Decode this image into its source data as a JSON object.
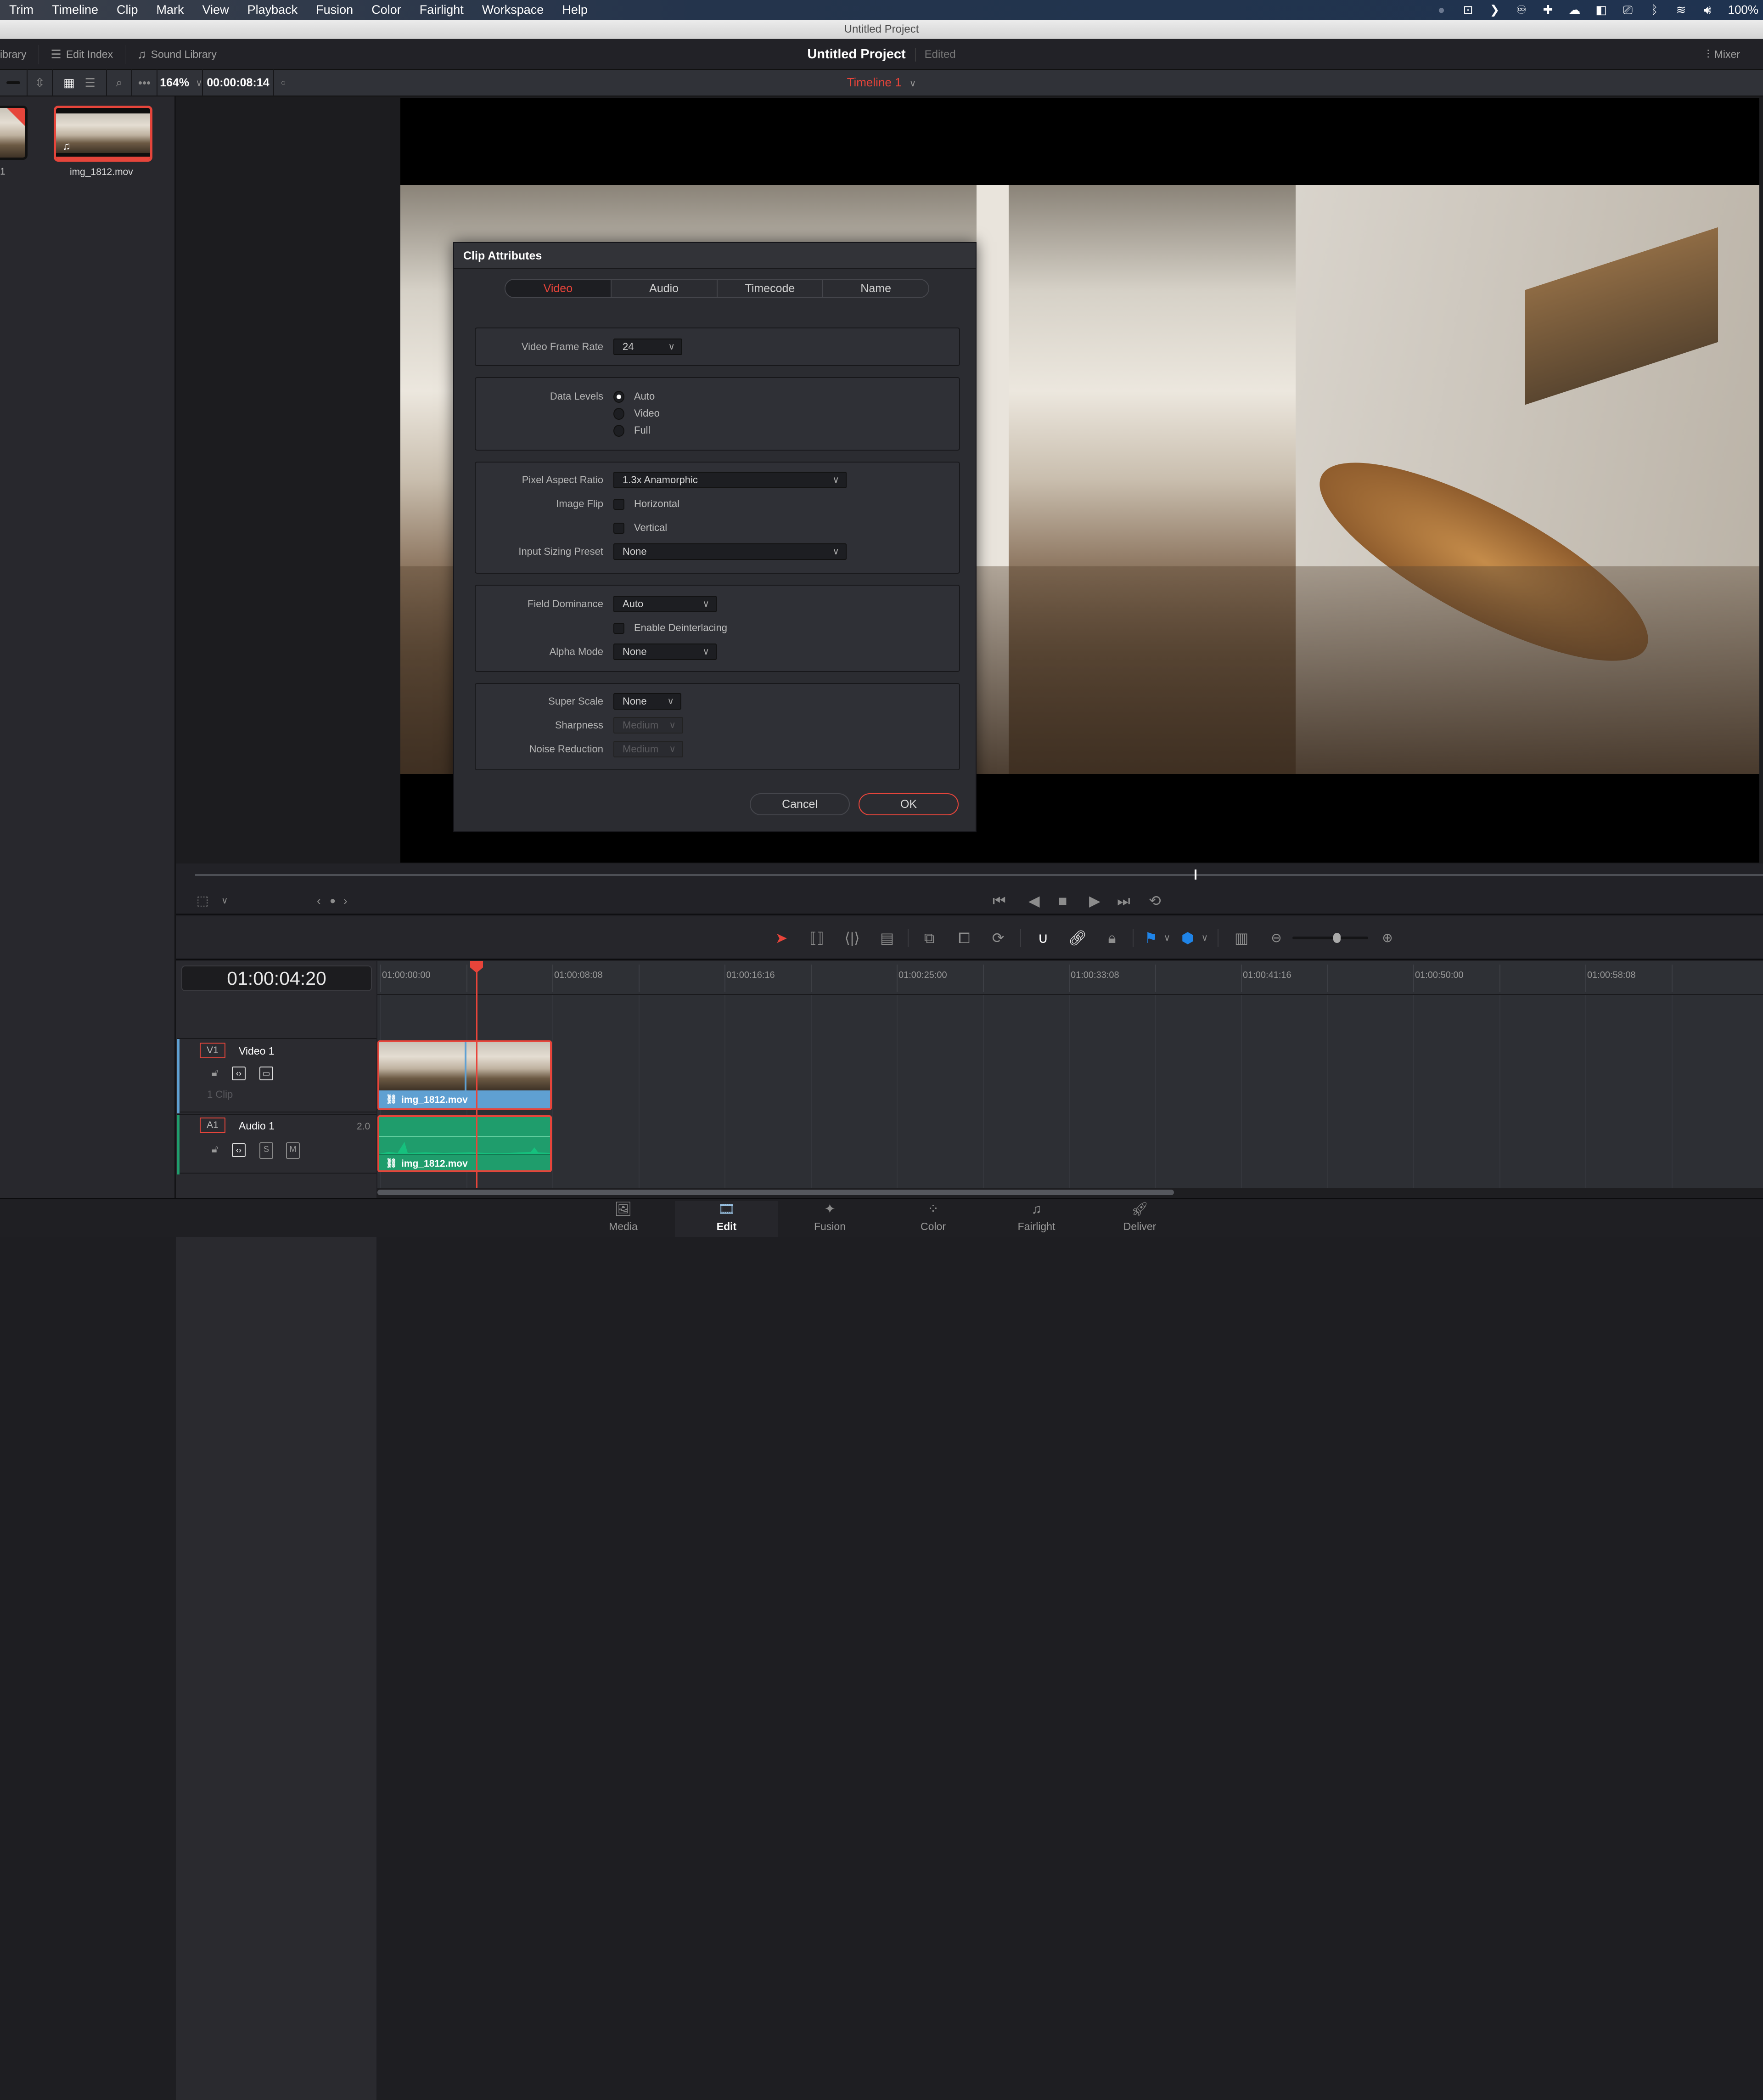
{
  "menubar": {
    "items": [
      "Trim",
      "Timeline",
      "Clip",
      "Mark",
      "View",
      "Playback",
      "Fusion",
      "Color",
      "Fairlight",
      "Workspace",
      "Help"
    ],
    "tray": {
      "battery": "100%"
    }
  },
  "window": {
    "title": "Untitled Project"
  },
  "header": {
    "left_buttons": [
      {
        "label": "ibrary",
        "icon": "library-icon"
      },
      {
        "label": "Edit Index",
        "icon": "list-icon"
      },
      {
        "label": "Sound Library",
        "icon": "music-list-icon"
      }
    ],
    "project_title": "Untitled Project",
    "project_status": "Edited",
    "mixer_label": "Mixer"
  },
  "subbar": {
    "zoom": "164%",
    "source_timecode": "00:00:08:14",
    "timeline_name": "Timeline 1"
  },
  "media_pool": {
    "clips": [
      {
        "name": "1",
        "partial": true,
        "used": true
      },
      {
        "name": "img_1812.mov",
        "selected": true,
        "has_audio": true
      }
    ]
  },
  "dialog": {
    "title": "Clip Attributes",
    "tabs": [
      {
        "label": "Video",
        "active": true
      },
      {
        "label": "Audio",
        "active": false
      },
      {
        "label": "Timecode",
        "active": false
      },
      {
        "label": "Name",
        "active": false
      }
    ],
    "video_frame_rate": {
      "label": "Video Frame Rate",
      "value": "24"
    },
    "data_levels": {
      "label": "Data Levels",
      "options": [
        "Auto",
        "Video",
        "Full"
      ],
      "selected": "Auto"
    },
    "pixel_aspect_ratio": {
      "label": "Pixel Aspect Ratio",
      "value": "1.3x Anamorphic"
    },
    "image_flip": {
      "label": "Image Flip",
      "horizontal": {
        "label": "Horizontal",
        "checked": false
      },
      "vertical": {
        "label": "Vertical",
        "checked": false
      }
    },
    "input_sizing_preset": {
      "label": "Input Sizing Preset",
      "value": "None"
    },
    "field_dominance": {
      "label": "Field Dominance",
      "value": "Auto"
    },
    "enable_deinterlacing": {
      "label": "Enable Deinterlacing",
      "checked": false
    },
    "alpha_mode": {
      "label": "Alpha Mode",
      "value": "None"
    },
    "super_scale": {
      "label": "Super Scale",
      "value": "None"
    },
    "sharpness": {
      "label": "Sharpness",
      "value": "Medium",
      "disabled": true
    },
    "noise_reduction": {
      "label": "Noise Reduction",
      "value": "Medium",
      "disabled": true
    },
    "cancel_label": "Cancel",
    "ok_label": "OK"
  },
  "timeline": {
    "current_timecode": "01:00:04:20",
    "ruler_labels": [
      "01:00:00:00",
      "01:00:08:08",
      "01:00:16:16",
      "01:00:25:00",
      "01:00:33:08",
      "01:00:41:16",
      "01:00:50:00",
      "01:00:58:08"
    ],
    "tracks": [
      {
        "id": "V1",
        "name": "Video 1",
        "info": "1 Clip",
        "clip": "img_1812.mov",
        "color": "#5fa0d2"
      },
      {
        "id": "A1",
        "name": "Audio 1",
        "channels": "2.0",
        "clip": "img_1812.mov",
        "color": "#1f9d6c"
      }
    ],
    "solo_label": "S",
    "mute_label": "M"
  },
  "pages": [
    {
      "label": "Media",
      "active": false
    },
    {
      "label": "Edit",
      "active": true
    },
    {
      "label": "Fusion",
      "active": false
    },
    {
      "label": "Color",
      "active": false
    },
    {
      "label": "Fairlight",
      "active": false
    },
    {
      "label": "Deliver",
      "active": false
    }
  ],
  "colors": {
    "accent_red": "#e8443a",
    "marker_blue": "#1f84e8"
  }
}
